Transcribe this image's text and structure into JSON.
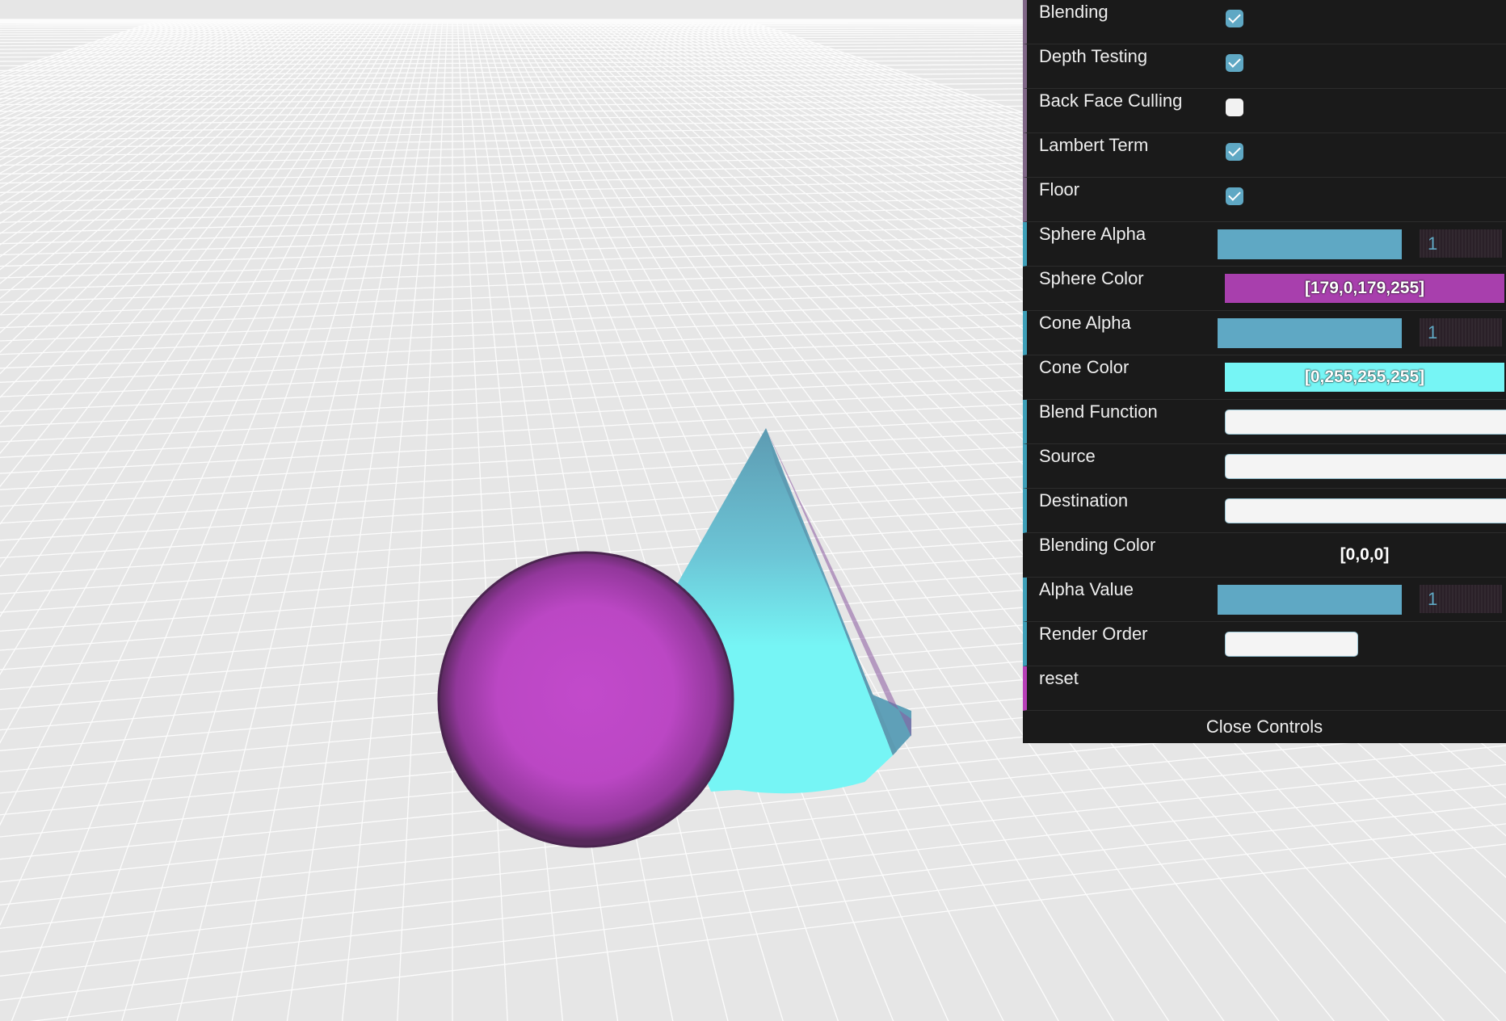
{
  "scene": {
    "floor_color": "#e6e6e6",
    "grid_color": "#ffffff",
    "sphere_color": "#c24acb",
    "cone_color": "#76f5f5"
  },
  "controls": {
    "blending": {
      "label": "Blending",
      "checked": true
    },
    "depth_testing": {
      "label": "Depth Testing",
      "checked": true
    },
    "back_face_culling": {
      "label": "Back Face Culling",
      "checked": false
    },
    "lambert_term": {
      "label": "Lambert Term",
      "checked": true
    },
    "floor": {
      "label": "Floor",
      "checked": true
    },
    "sphere_alpha": {
      "label": "Sphere Alpha",
      "value": "1",
      "fill": 1.0
    },
    "sphere_color": {
      "label": "Sphere Color",
      "value": "[179,0,179,255]",
      "color": "#a83fad"
    },
    "cone_alpha": {
      "label": "Cone Alpha",
      "value": "1",
      "fill": 1.0
    },
    "cone_color": {
      "label": "Cone Color",
      "value": "[0,255,255,255]",
      "color": "#76f5f5"
    },
    "blend_function": {
      "label": "Blend Function",
      "value": ""
    },
    "source": {
      "label": "Source",
      "value": ""
    },
    "destination": {
      "label": "Destination",
      "value": ""
    },
    "blending_color": {
      "label": "Blending Color",
      "value": "[0,0,0]"
    },
    "alpha_value": {
      "label": "Alpha Value",
      "value": "1",
      "fill": 1.0
    },
    "render_order": {
      "label": "Render Order",
      "value": ""
    },
    "reset": {
      "label": "reset"
    },
    "close": {
      "label": "Close Controls"
    }
  }
}
